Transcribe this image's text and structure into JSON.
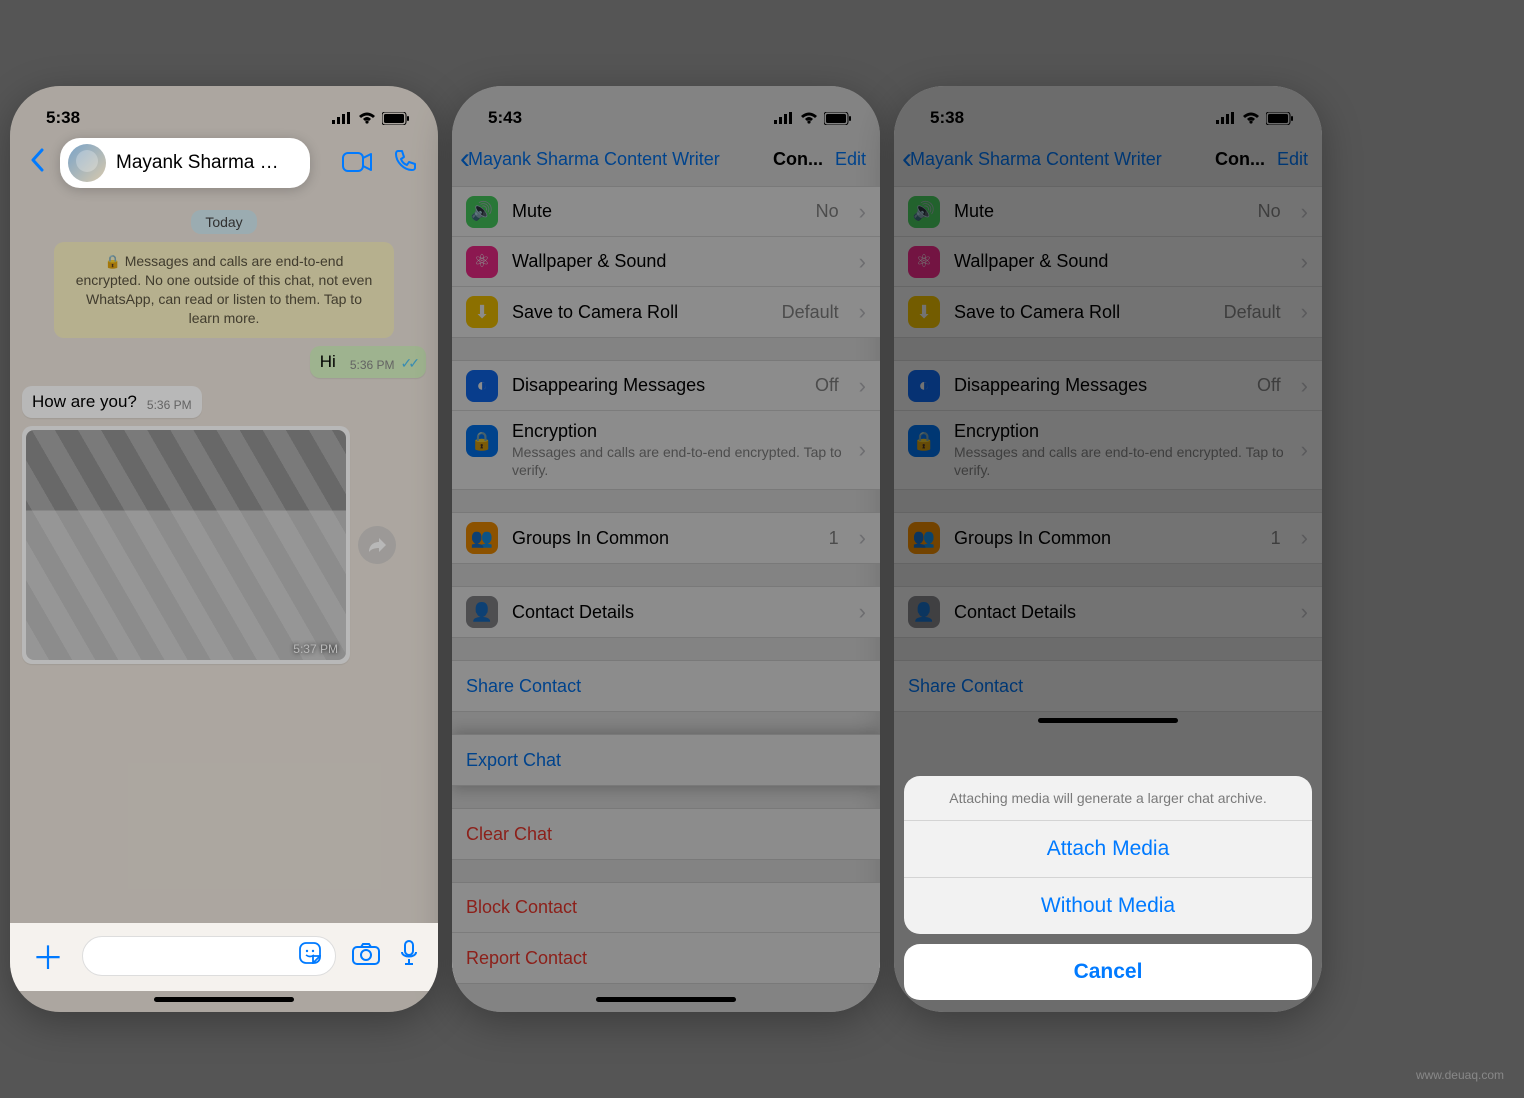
{
  "watermark": "www.deuaq.com",
  "phone1": {
    "status_time": "5:38",
    "contact_name": "Mayank Sharma Co...",
    "date_label": "Today",
    "encryption_text": "Messages and calls are end-to-end encrypted. No one outside of this chat, not even WhatsApp, can read or listen to them. Tap to learn more.",
    "msg_out": "Hi",
    "msg_out_time": "5:36 PM",
    "msg_in": "How are you?",
    "msg_in_time": "5:36 PM",
    "image_time": "5:37 PM"
  },
  "phone2": {
    "status_time": "5:43",
    "back_label": "Mayank Sharma Content Writer",
    "title": "Con...",
    "edit": "Edit",
    "rows": {
      "mute": "Mute",
      "mute_val": "No",
      "wallpaper": "Wallpaper & Sound",
      "camera": "Save to Camera Roll",
      "camera_val": "Default",
      "disappearing": "Disappearing Messages",
      "disappearing_val": "Off",
      "encryption": "Encryption",
      "encryption_sub": "Messages and calls are end-to-end encrypted. Tap to verify.",
      "groups": "Groups In Common",
      "groups_val": "1",
      "contact_details": "Contact Details",
      "share": "Share Contact",
      "export": "Export Chat",
      "clear": "Clear Chat",
      "block": "Block Contact",
      "report": "Report Contact"
    }
  },
  "phone3": {
    "status_time": "5:38",
    "back_label": "Mayank Sharma Content Writer",
    "title": "Con...",
    "edit": "Edit",
    "rows": {
      "mute": "Mute",
      "mute_val": "No",
      "wallpaper": "Wallpaper & Sound",
      "camera": "Save to Camera Roll",
      "camera_val": "Default",
      "disappearing": "Disappearing Messages",
      "disappearing_val": "Off",
      "encryption": "Encryption",
      "encryption_sub": "Messages and calls are end-to-end encrypted. Tap to verify.",
      "groups": "Groups In Common",
      "groups_val": "1",
      "contact_details": "Contact Details",
      "share": "Share Contact"
    },
    "sheet": {
      "hint": "Attaching media will generate a larger chat archive.",
      "attach": "Attach Media",
      "without": "Without Media",
      "cancel": "Cancel"
    }
  }
}
